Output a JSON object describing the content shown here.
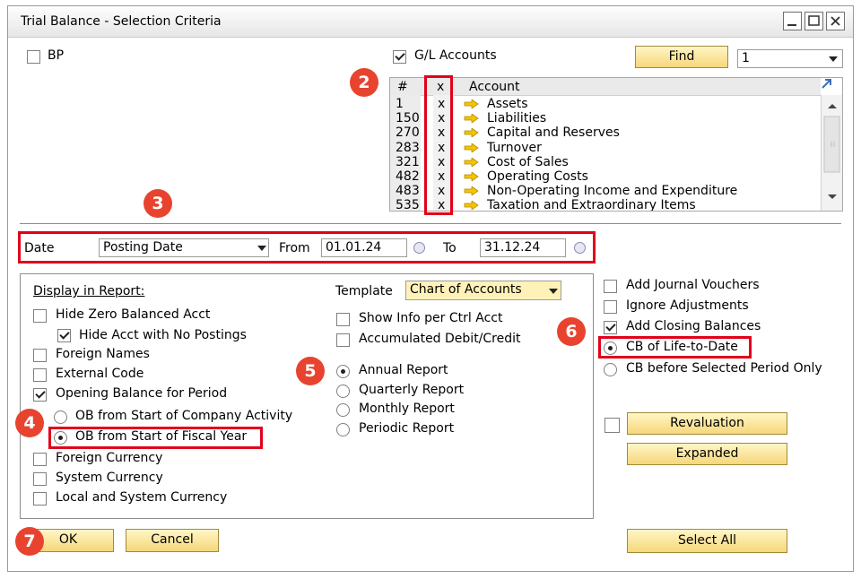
{
  "window": {
    "title": "Trial Balance - Selection Criteria"
  },
  "top": {
    "bp_label": "BP",
    "gl_label": "G/L Accounts",
    "find_label": "Find",
    "find_select": "1"
  },
  "accounts": {
    "columns": [
      "#",
      "x",
      "Account"
    ],
    "rows": [
      {
        "num": "1",
        "x": "x",
        "name": "Assets"
      },
      {
        "num": "150",
        "x": "x",
        "name": "Liabilities"
      },
      {
        "num": "270",
        "x": "x",
        "name": "Capital and Reserves"
      },
      {
        "num": "283",
        "x": "x",
        "name": "Turnover"
      },
      {
        "num": "321",
        "x": "x",
        "name": "Cost of Sales"
      },
      {
        "num": "482",
        "x": "x",
        "name": "Operating Costs"
      },
      {
        "num": "483",
        "x": "x",
        "name": "Non-Operating Income and Expenditure"
      },
      {
        "num": "535",
        "x": "x",
        "name": "Taxation and Extraordinary Items"
      }
    ]
  },
  "date": {
    "label": "Date",
    "type": "Posting Date",
    "from_label": "From",
    "from": "01.01.24",
    "to_label": "To",
    "to": "31.12.24"
  },
  "display": {
    "heading": "Display in Report:",
    "hide_zero": "Hide Zero Balanced Acct",
    "hide_no_postings": "Hide Acct with No Postings",
    "foreign_names": "Foreign Names",
    "external_code": "External Code",
    "opening_balance": "Opening Balance for Period",
    "ob_company": "OB from Start of Company Activity",
    "ob_fiscal": "OB from Start of Fiscal Year",
    "foreign_currency": "Foreign Currency",
    "system_currency": "System Currency",
    "local_system_currency": "Local and System Currency"
  },
  "template": {
    "label": "Template",
    "value": "Chart of Accounts",
    "show_info": "Show Info per Ctrl Acct",
    "accumulated": "Accumulated Debit/Credit",
    "annual": "Annual Report",
    "quarterly": "Quarterly Report",
    "monthly": "Monthly Report",
    "periodic": "Periodic Report"
  },
  "right": {
    "add_jv": "Add Journal Vouchers",
    "ignore_adj": "Ignore Adjustments",
    "add_closing": "Add Closing Balances",
    "cb_life": "CB of Life-to-Date",
    "cb_before": "CB before Selected Period Only",
    "revaluation": "Revaluation",
    "expanded": "Expanded",
    "select_all": "Select All"
  },
  "footer": {
    "ok": "OK",
    "cancel": "Cancel"
  },
  "badges": [
    "2",
    "3",
    "4",
    "5",
    "6",
    "7"
  ],
  "colors": {
    "badge": "#e8432f",
    "highlight": "#e2001a",
    "button": "#f6d77a"
  }
}
